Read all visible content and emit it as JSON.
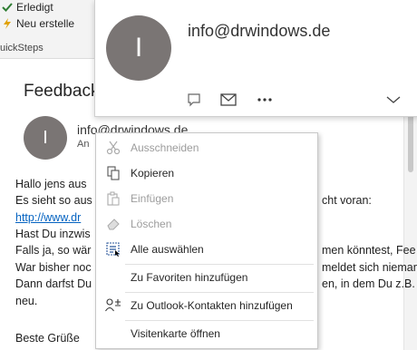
{
  "ribbon": {
    "done_label": "Erledigt",
    "new_label": "Neu erstelle",
    "quicksteps_label": "uickSteps"
  },
  "message": {
    "subject": "Feedback",
    "avatar_initial": "I",
    "sender": "info@drwindows.de",
    "recipient_prefix": "An",
    "body": [
      {
        "left": "Hallo jens aus",
        "right": ""
      },
      {
        "left": "Es sieht so aus",
        "right": "cht voran:"
      },
      {
        "left": "http://www.dr",
        "right": "",
        "link": true
      },
      {
        "left": "Hast Du inzwis",
        "right": ""
      },
      {
        "left": "Falls ja, so wär",
        "right": "men könntest, Fee"
      },
      {
        "left": "War bisher noc",
        "right": "meldet sich nieman"
      },
      {
        "left": "Dann darfst Du",
        "right": "en, in dem Du z.B. e"
      },
      {
        "left": "neu.",
        "right": ""
      },
      {
        "left": "Beste Grüße",
        "right": ""
      }
    ]
  },
  "contact_card": {
    "avatar_initial": "I",
    "email": "info@drwindows.de",
    "actions": [
      "chat-icon",
      "mail-icon",
      "more-icon",
      "chevron-down-icon"
    ]
  },
  "context_menu": {
    "items": [
      {
        "label": "Ausschneiden",
        "icon": "cut-icon",
        "disabled": true
      },
      {
        "label": "Kopieren",
        "icon": "copy-icon",
        "disabled": false
      },
      {
        "label": "Einfügen",
        "icon": "paste-icon",
        "disabled": true
      },
      {
        "label": "Löschen",
        "icon": "erase-icon",
        "disabled": true
      },
      {
        "label": "Alle auswählen",
        "icon": "select-all-icon",
        "disabled": false
      },
      {
        "label": "Zu Favoriten hinzufügen",
        "icon": "",
        "disabled": false
      },
      {
        "label": "Zu Outlook-Kontakten hinzufügen",
        "icon": "add-contact-icon",
        "disabled": false
      },
      {
        "label": "Visitenkarte öffnen",
        "icon": "",
        "disabled": false
      }
    ]
  },
  "colors": {
    "avatar_bg": "#7a7574",
    "link": "#0563c1",
    "done_check": "#2e7d32",
    "menu_icon": "#2b579a"
  }
}
